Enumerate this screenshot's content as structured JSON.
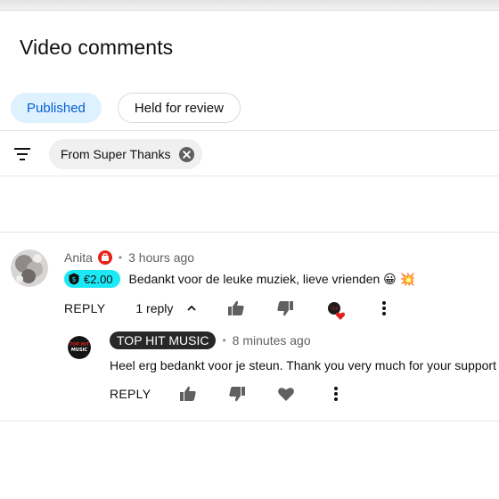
{
  "page": {
    "title": "Video comments"
  },
  "tabs": [
    {
      "label": "Published",
      "active": true
    },
    {
      "label": "Held for review",
      "active": false
    }
  ],
  "filter": {
    "chip_label": "From Super Thanks",
    "icon": "filter-icon",
    "close_icon": "close-circle-icon"
  },
  "comment": {
    "author": "Anita",
    "badge_icon": "member-badge-icon",
    "time": "3 hours ago",
    "super_thanks": {
      "amount": "€2.00",
      "color": "#1de9f6"
    },
    "text": "Bedankt voor de leuke muziek, lieve vrienden 😀 💥",
    "reply_label": "REPLY",
    "replies_label": "1 reply",
    "icons": [
      "like-icon",
      "dislike-icon",
      "creator-heart-icon",
      "more-icon"
    ]
  },
  "reply": {
    "author": "TOP HIT MUSIC",
    "time": "8 minutes ago",
    "text": "Heel erg bedankt voor je steun. Thank you very much for your support 😀",
    "reply_label": "REPLY",
    "avatar_text": "TOP HIT MUSIC",
    "icons": [
      "like-icon",
      "dislike-icon",
      "heart-icon",
      "more-icon"
    ]
  },
  "colors": {
    "accent": "#065fd4",
    "active_tab_bg": "#def1ff",
    "heart": "#e02121"
  }
}
